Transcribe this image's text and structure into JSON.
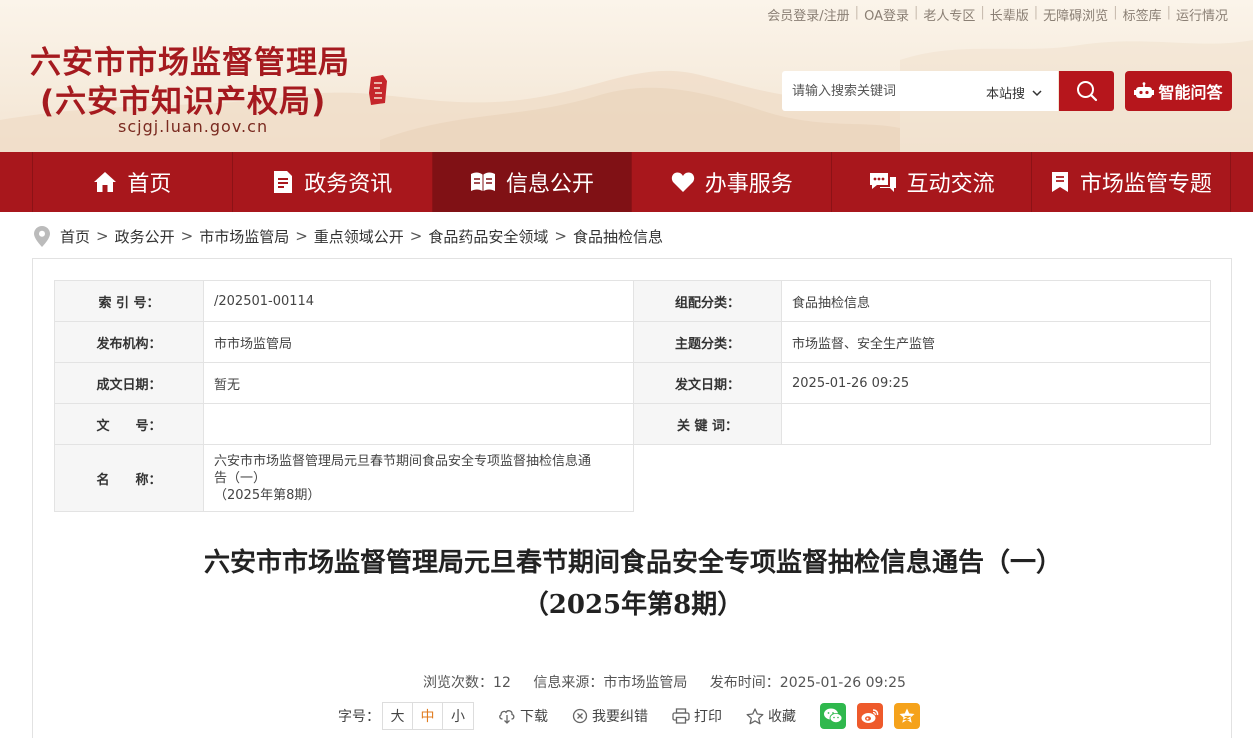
{
  "toplinks": [
    "会员登录/注册",
    "OA登录",
    "老人专区",
    "长辈版",
    "无障碍浏览",
    "标签库",
    "运行情况"
  ],
  "header": {
    "title_line1": "六安市市场监督管理局",
    "title_line2": "(六安市知识产权局)",
    "domain": "scjgj.luan.gov.cn",
    "brand_color": "#a8171c"
  },
  "search": {
    "placeholder": "请输入搜索关键词",
    "scope": "本站搜",
    "ai_label": "智能问答"
  },
  "nav": [
    {
      "label": "首页",
      "icon": "home-icon"
    },
    {
      "label": "政务资讯",
      "icon": "document-icon"
    },
    {
      "label": "信息公开",
      "icon": "book-icon",
      "active": true
    },
    {
      "label": "办事服务",
      "icon": "heart-icon"
    },
    {
      "label": "互动交流",
      "icon": "chat-icon"
    },
    {
      "label": "市场监管专题",
      "icon": "bookmark-icon"
    }
  ],
  "breadcrumb": [
    "首页",
    "政务公开",
    "市市场监管局",
    "重点领域公开",
    "食品药品安全领域",
    "食品抽检信息"
  ],
  "meta": {
    "index_label": "索 引 号：",
    "index_value": "/202501-00114",
    "category_label": "组配分类：",
    "category_value": "食品抽检信息",
    "org_label": "发布机构：",
    "org_value": "市市场监管局",
    "topic_label": "主题分类：",
    "topic_value": "市场监督、安全生产监管",
    "date_label": "成文日期：",
    "date_value": "暂无",
    "pubdate_label": "发文日期：",
    "pubdate_value": "2025-01-26 09:25",
    "docno_label": "文　　号：",
    "docno_value": "",
    "keywords_label": "关 键 词：",
    "keywords_value": "",
    "name_label": "名　　称：",
    "name_line1": "六安市市场监督管理局元旦春节期间食品安全专项监督抽检信息通",
    "name_line2": "告（一）",
    "name_line3": "（2025年第8期）"
  },
  "article": {
    "title_line1": "六安市市场监督管理局元旦春节期间食品安全专项监督抽检信息通告（一）",
    "title_line2": "（2025年第8期）",
    "views": "浏览次数：12",
    "source": "信息来源：市市场监管局",
    "published": "发布时间：2025-01-26 09:25"
  },
  "tools": {
    "fontsize_label": "字号：",
    "font_large": "大",
    "font_medium": "中",
    "font_small": "小",
    "download": "下载",
    "correction": "我要纠错",
    "print": "打印",
    "favorite": "收藏"
  }
}
